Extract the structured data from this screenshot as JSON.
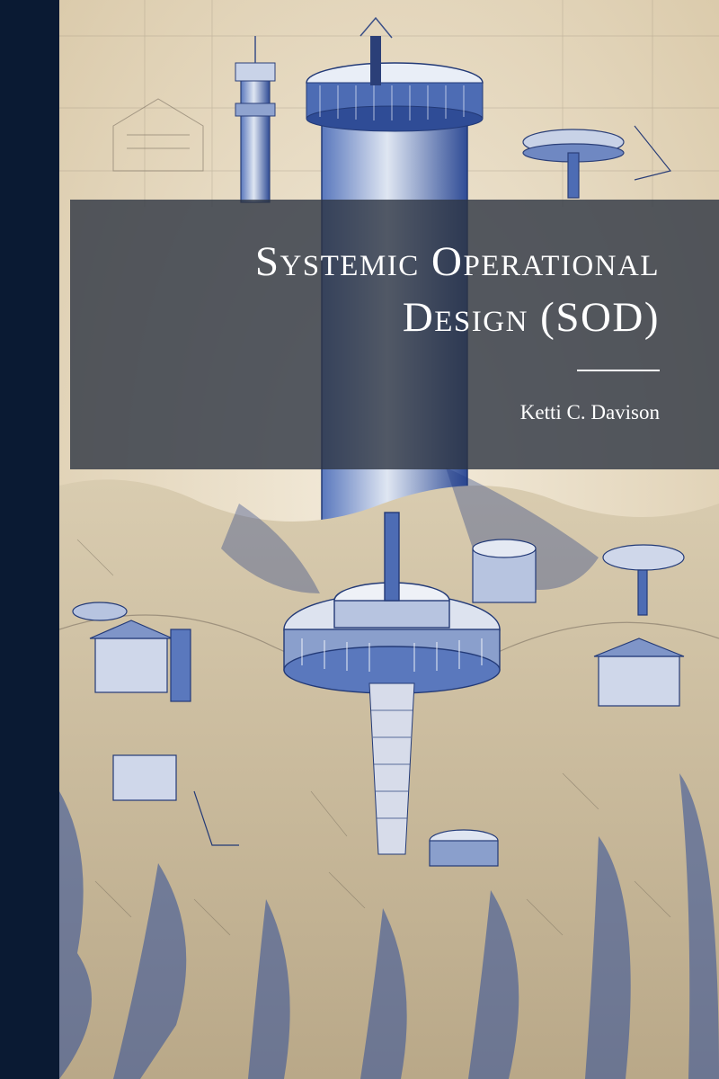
{
  "book": {
    "title_line1": "Systemic Operational",
    "title_line2": "Design (SOD)",
    "author": "Ketti C. Davison"
  },
  "colors": {
    "spine": "#0a1a33",
    "paper": "#efe6d4",
    "ink_blue": "#2e4d99",
    "panel": "#2d3442",
    "rule": "#ffffff"
  },
  "illustration": "blueprint-sketch-of-citadel-icon"
}
